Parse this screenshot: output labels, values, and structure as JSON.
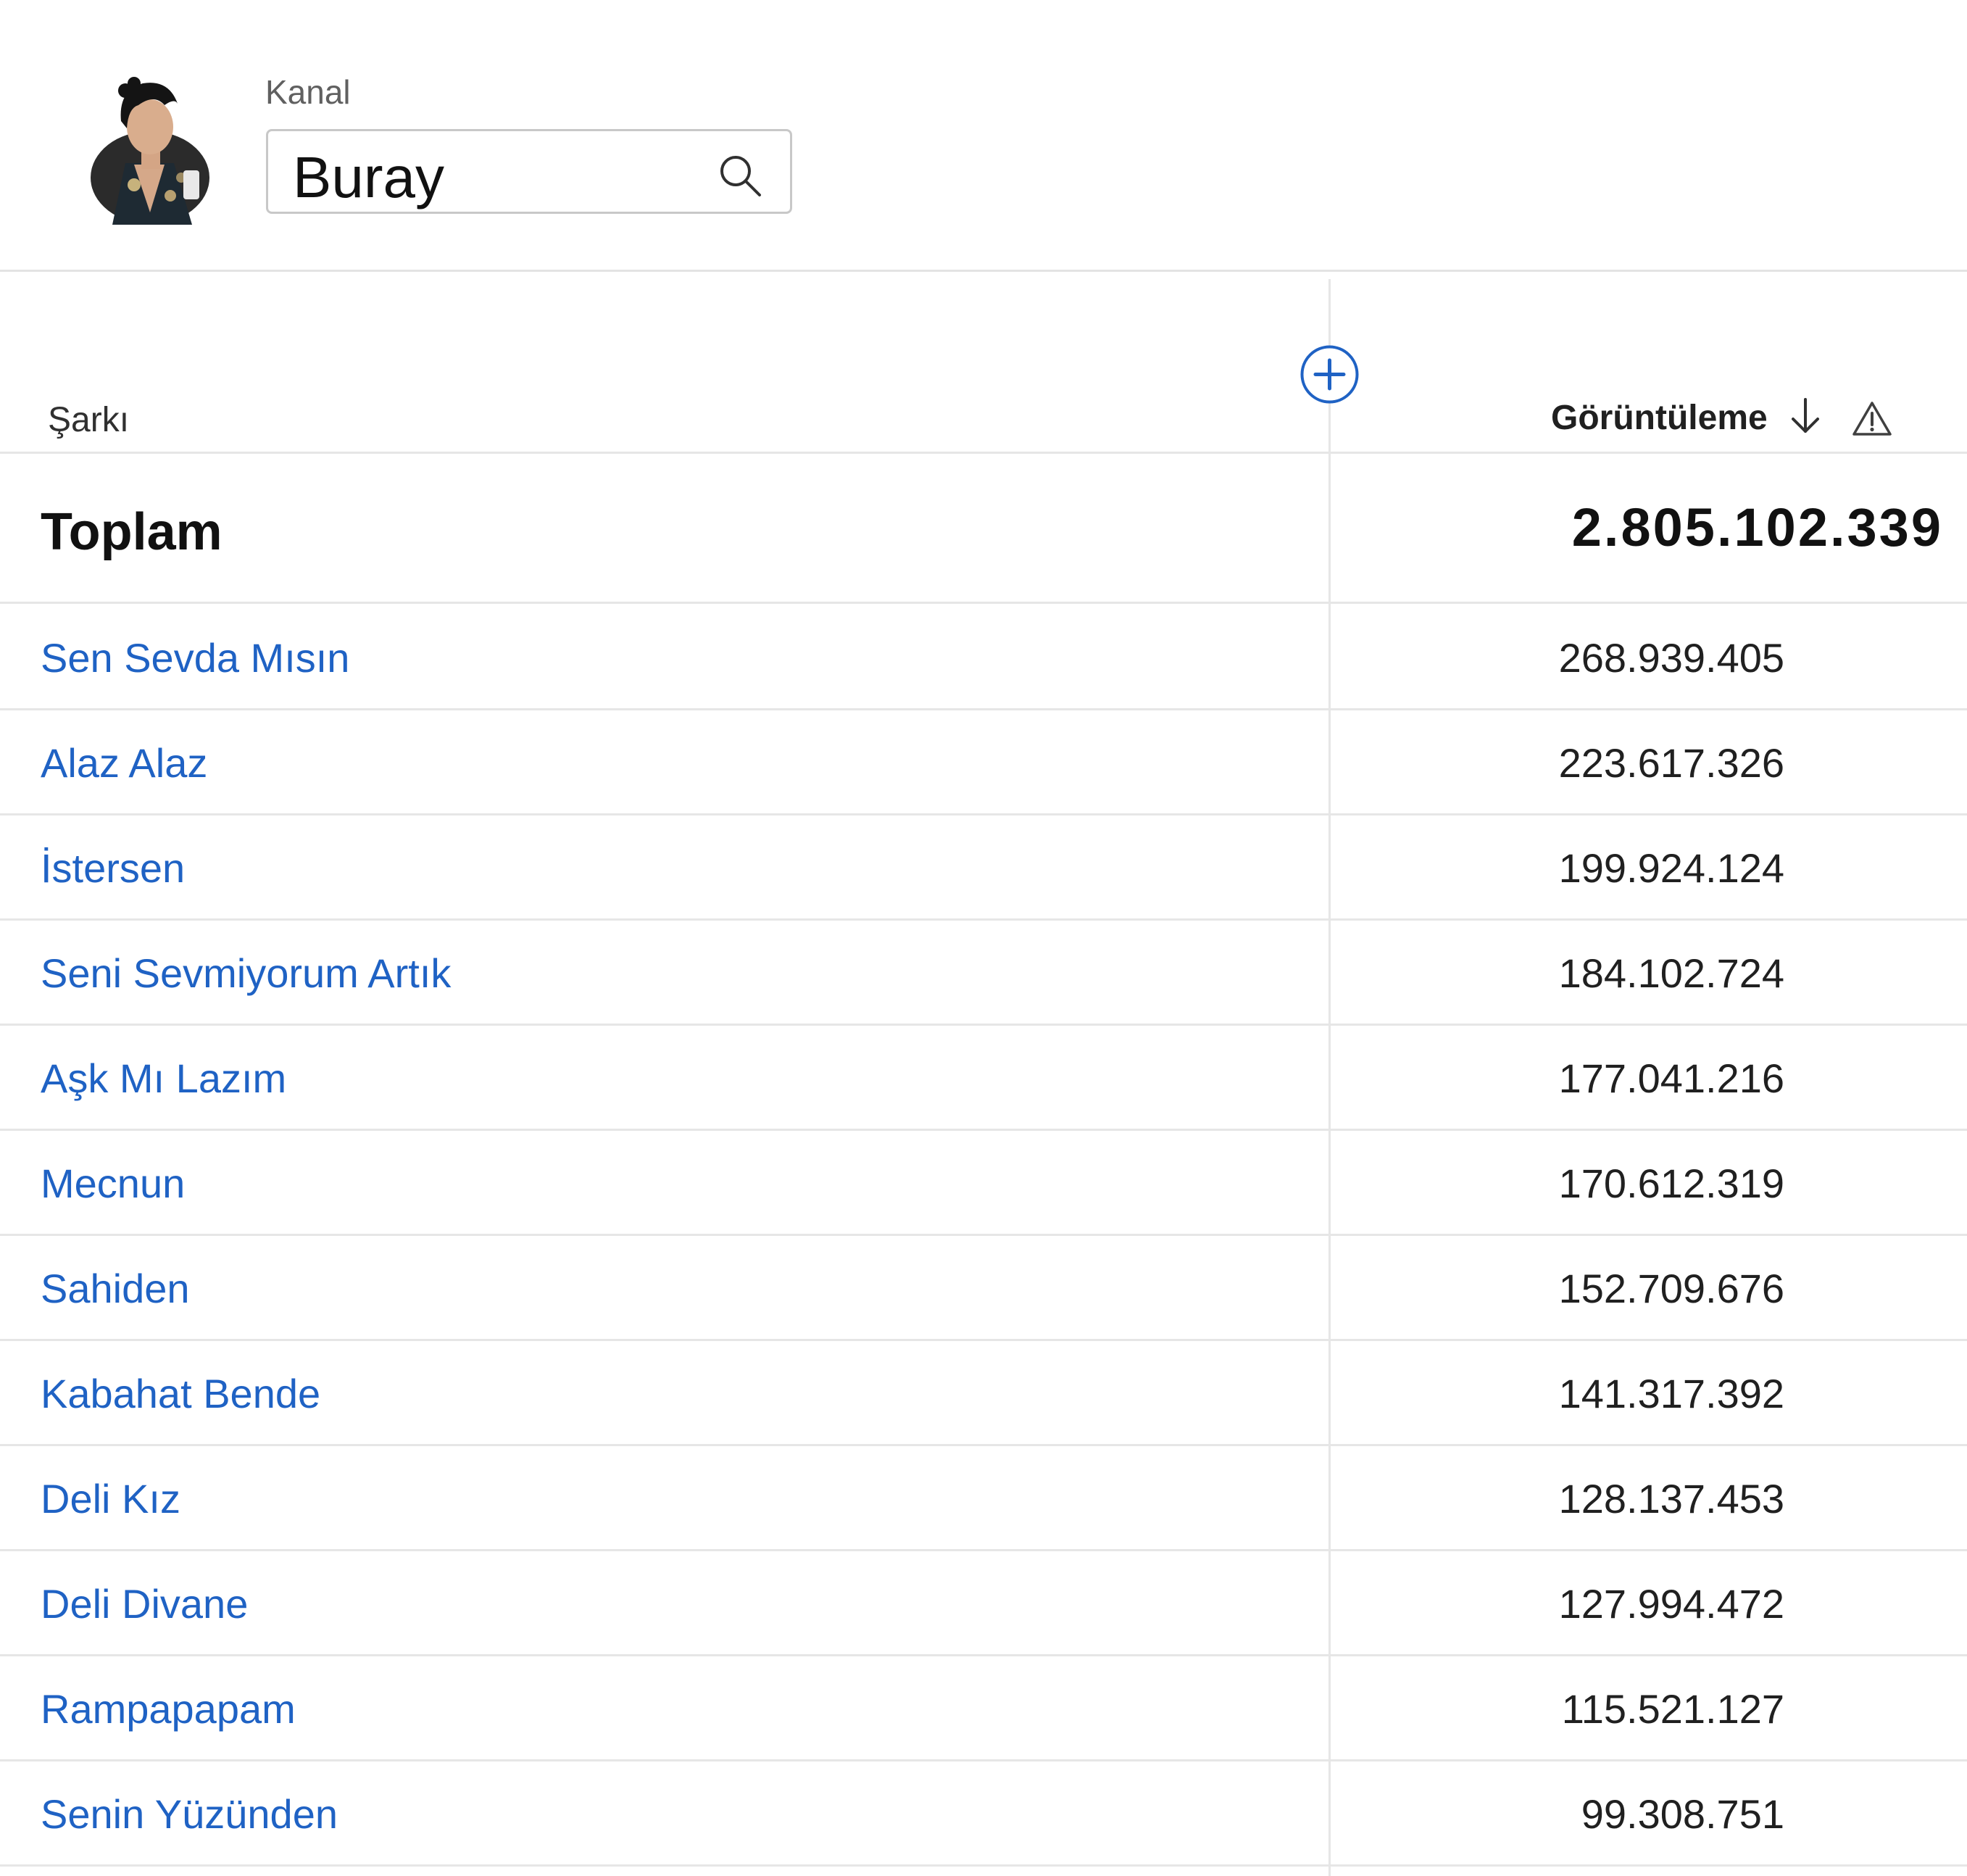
{
  "header": {
    "channel_label": "Kanal",
    "search_value": "Buray",
    "avatar_icon": "artist-avatar",
    "search_icon": "search-icon"
  },
  "table": {
    "columns": {
      "song": "Şarkı",
      "views": "Görüntüleme"
    },
    "icons": {
      "add_column": "add-circle-icon",
      "sort": "arrow-down-icon",
      "warning": "warning-triangle-icon"
    },
    "total": {
      "label": "Toplam",
      "value": "2.805.102.339"
    },
    "rows": [
      {
        "song": "Sen Sevda Mısın",
        "views": "268.939.405"
      },
      {
        "song": "Alaz Alaz",
        "views": "223.617.326"
      },
      {
        "song": "İstersen",
        "views": "199.924.124"
      },
      {
        "song": "Seni Sevmiyorum Artık",
        "views": "184.102.724"
      },
      {
        "song": "Aşk Mı Lazım",
        "views": "177.041.216"
      },
      {
        "song": "Mecnun",
        "views": "170.612.319"
      },
      {
        "song": "Sahiden",
        "views": "152.709.676"
      },
      {
        "song": "Kabahat Bende",
        "views": "141.317.392"
      },
      {
        "song": "Deli Kız",
        "views": "128.137.453"
      },
      {
        "song": "Deli Divane",
        "views": "127.994.472"
      },
      {
        "song": "Rampapapam",
        "views": "115.521.127"
      },
      {
        "song": "Senin Yüzünden",
        "views": "99.308.751"
      }
    ]
  },
  "colors": {
    "link": "#1f62c4",
    "divider": "#e6e6e6"
  }
}
